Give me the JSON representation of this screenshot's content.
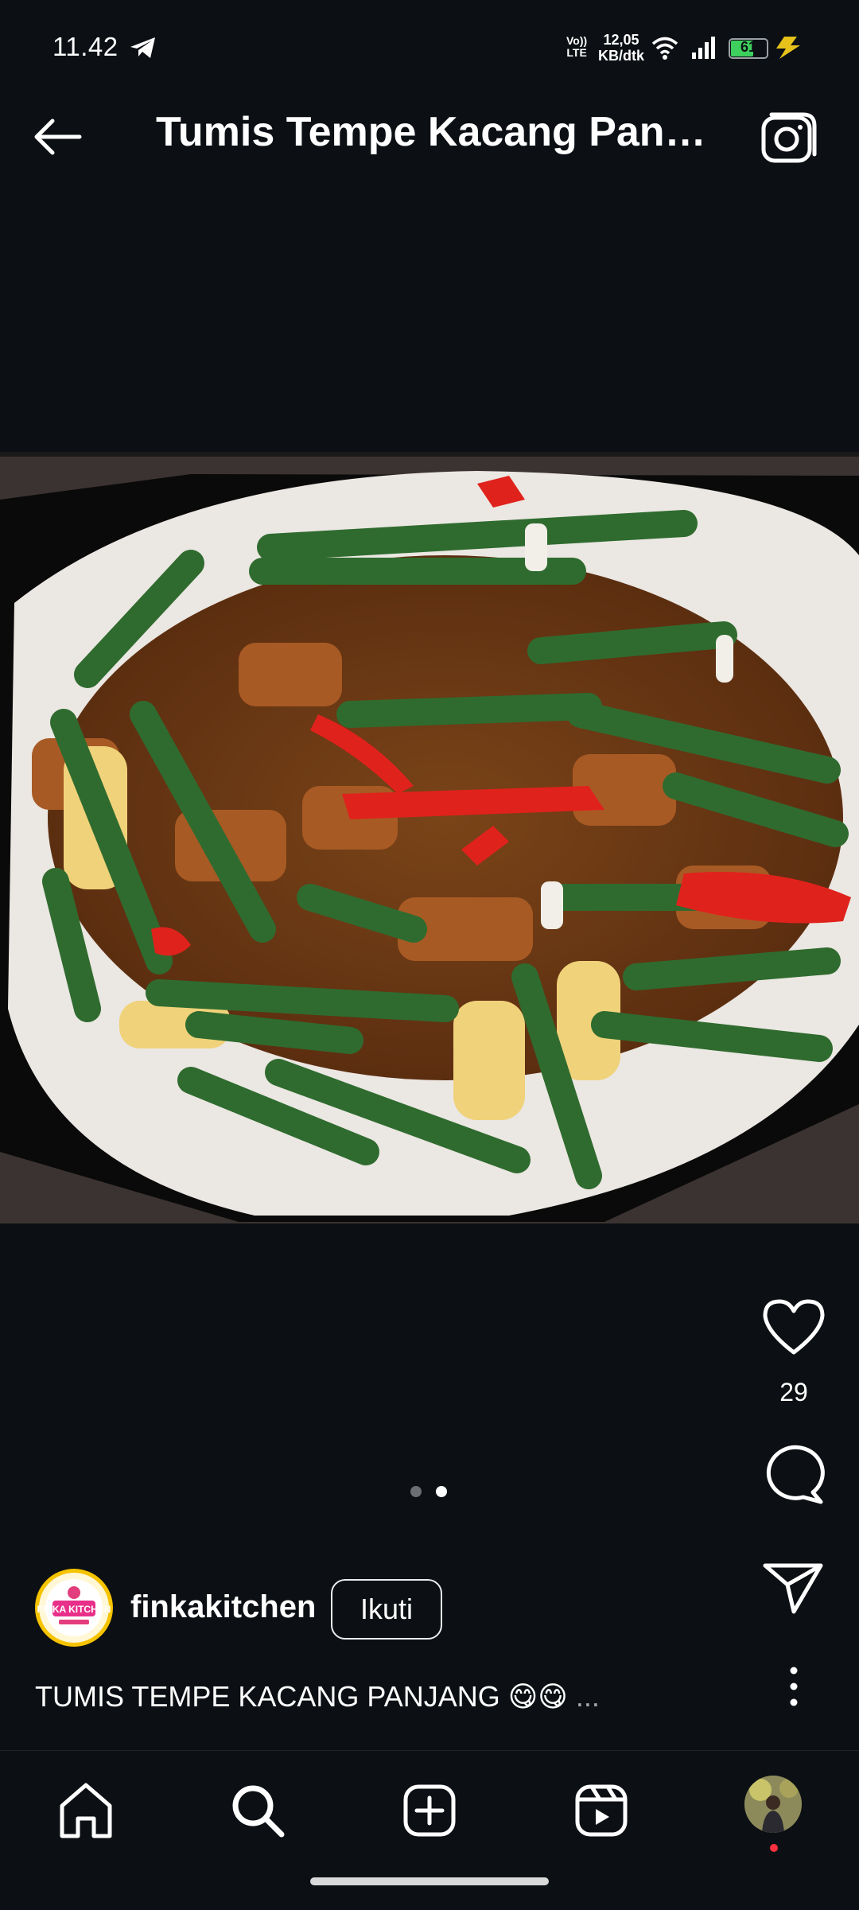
{
  "status_bar": {
    "time": "11.42",
    "network_top": "Vo))",
    "network_bottom": "LTE",
    "speed_top": "12,05",
    "speed_bottom": "KB/dtk",
    "battery": "61",
    "icons": [
      "telegram-icon",
      "wifi-icon",
      "signal-icon",
      "battery-icon",
      "charging-icon"
    ]
  },
  "header": {
    "title": "Tumis Tempe Kacang Pan…",
    "icons": [
      "back-arrow-icon",
      "camera-icon"
    ]
  },
  "post": {
    "image_alt": "Stir-fried tempeh with long beans, baby corn and red chili on a white plate",
    "carousel": {
      "total": 2,
      "active": 2
    },
    "like_count": "29",
    "author": {
      "username": "finkakitchen",
      "avatar_text": "FINKA KITCHEN"
    },
    "follow_label": "Ikuti",
    "caption": "TUMIS TEMPE KACANG PANJANG 😋😋",
    "caption_more": "...",
    "actions": [
      "heart-icon",
      "comment-icon",
      "share-icon",
      "more-icon"
    ]
  },
  "bottom_nav": {
    "items": [
      "home-icon",
      "search-icon",
      "create-icon",
      "reels-icon",
      "profile-avatar"
    ]
  },
  "colors": {
    "background": "#0c1014",
    "text": "#ffffff",
    "notification_dot": "#ff3040",
    "battery_fill": "#3ecf5c"
  }
}
